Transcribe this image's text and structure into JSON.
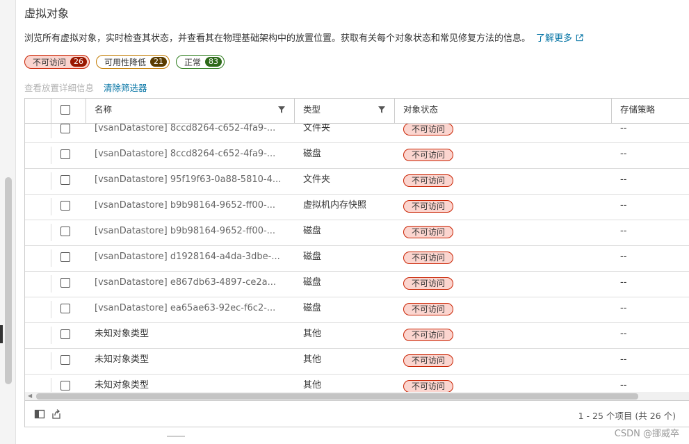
{
  "page": {
    "title": "虚拟对象",
    "description": "浏览所有虚拟对象，实时检查其状态，并查看其在物理基础架构中的放置位置。获取有关每个对象状态和常见修复方法的信息。",
    "learn_more": "了解更多"
  },
  "chips": [
    {
      "label": "不可访问",
      "count": "26"
    },
    {
      "label": "可用性降低",
      "count": "21"
    },
    {
      "label": "正常",
      "count": "83"
    }
  ],
  "actions": {
    "view_placement": "查看放置详细信息",
    "clear_filter": "清除筛选器"
  },
  "columns": {
    "name": "名称",
    "type": "类型",
    "status": "对象状态",
    "policy": "存储策略"
  },
  "rows": [
    {
      "name": "[vsanDatastore] 8ccd8264-c652-4fa9-...",
      "type": "文件夹",
      "status": "不可访问",
      "policy": "--"
    },
    {
      "name": "[vsanDatastore] 8ccd8264-c652-4fa9-...",
      "type": "磁盘",
      "status": "不可访问",
      "policy": "--"
    },
    {
      "name": "[vsanDatastore] 95f19f63-0a88-5810-4...",
      "type": "文件夹",
      "status": "不可访问",
      "policy": "--"
    },
    {
      "name": "[vsanDatastore] b9b98164-9652-ff00-...",
      "type": "虚拟机内存快照",
      "status": "不可访问",
      "policy": "--"
    },
    {
      "name": "[vsanDatastore] b9b98164-9652-ff00-...",
      "type": "磁盘",
      "status": "不可访问",
      "policy": "--"
    },
    {
      "name": "[vsanDatastore] d1928164-a4da-3dbe-...",
      "type": "磁盘",
      "status": "不可访问",
      "policy": "--"
    },
    {
      "name": "[vsanDatastore] e867db63-4897-ce2a...",
      "type": "磁盘",
      "status": "不可访问",
      "policy": "--"
    },
    {
      "name": "[vsanDatastore] ea65ae63-92ec-f6c2-...",
      "type": "磁盘",
      "status": "不可访问",
      "policy": "--"
    },
    {
      "name": "未知对象类型",
      "type": "其他",
      "status": "不可访问",
      "policy": "--"
    },
    {
      "name": "未知对象类型",
      "type": "其他",
      "status": "不可访问",
      "policy": "--"
    },
    {
      "name": "未知对象类型",
      "type": "其他",
      "status": "不可访问",
      "policy": "--"
    }
  ],
  "pagination": "1 - 25 个项目 (共 26 个)",
  "watermark": "CSDN @挪威卒",
  "icons": {
    "external_link": "external-link-icon",
    "filter": "filter-icon",
    "column_toggle": "column-toggle-icon",
    "export": "export-icon"
  },
  "colors": {
    "accent": "#0072a3",
    "danger": "#c92100",
    "danger_bg": "#fbd5cf",
    "warning": "#c27b00",
    "success": "#2e7d1e"
  }
}
